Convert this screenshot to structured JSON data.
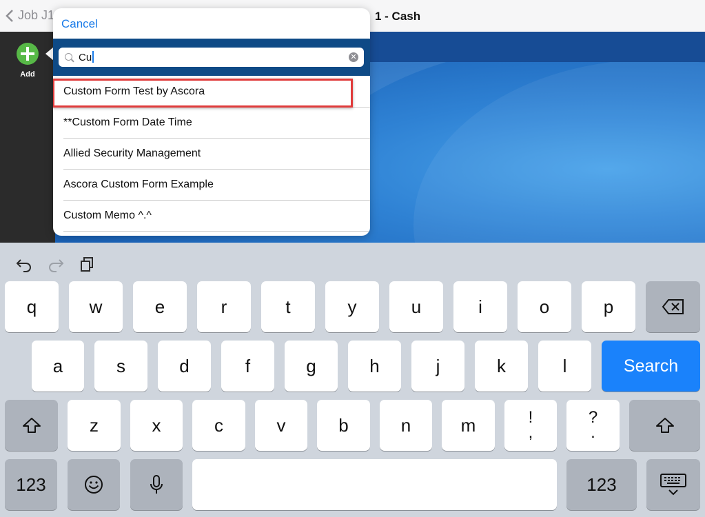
{
  "nav": {
    "back_label": "Job J1",
    "title": "1 - Cash"
  },
  "sidebar": {
    "add_label": "Add"
  },
  "popover": {
    "cancel_label": "Cancel",
    "search_value": "Cu",
    "results": [
      "Custom Form Test by Ascora",
      "**Custom Form Date Time",
      "Allied Security Management",
      "Ascora Custom Form Example",
      "Custom Memo ^.^"
    ],
    "highlighted_index": 0
  },
  "keyboard": {
    "row1": [
      "q",
      "w",
      "e",
      "r",
      "t",
      "y",
      "u",
      "i",
      "o",
      "p"
    ],
    "row2": [
      "a",
      "s",
      "d",
      "f",
      "g",
      "h",
      "j",
      "k",
      "l"
    ],
    "row3": [
      "z",
      "x",
      "c",
      "v",
      "b",
      "n",
      "m"
    ],
    "punct1_top": "!",
    "punct1_bottom": ",",
    "punct2_top": "?",
    "punct2_bottom": ".",
    "search_label": "Search",
    "numbers_label": "123",
    "accent": "#1a82fb"
  },
  "icons": {
    "undo": "undo-icon",
    "redo": "redo-icon",
    "paste": "paste-icon",
    "backspace": "backspace-icon",
    "shift": "shift-icon",
    "emoji": "emoji-icon",
    "mic": "microphone-icon",
    "hide_keyboard": "hide-keyboard-icon"
  }
}
